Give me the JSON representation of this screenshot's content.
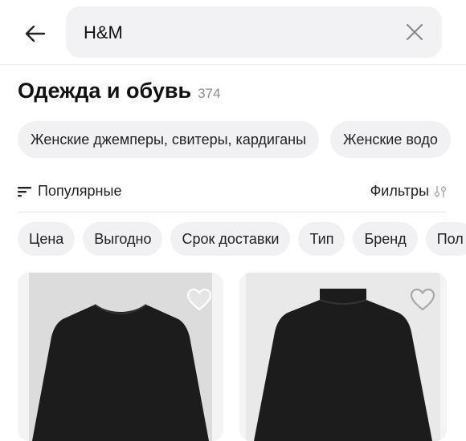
{
  "search": {
    "query": "H&M"
  },
  "category": {
    "title": "Одежда и обувь",
    "count": "374"
  },
  "category_chips": [
    "Женские джемперы, свитеры, кардиганы",
    "Женские водо"
  ],
  "sort": {
    "label": "Популярные"
  },
  "filters": {
    "label": "Фильтры"
  },
  "filter_chips": [
    "Цена",
    "Выгодно",
    "Срок доставки",
    "Тип",
    "Бренд",
    "Пол"
  ],
  "products": [
    {
      "image": "black-longsleeve-top-icon",
      "favorite_icon": "heart-outline-icon"
    },
    {
      "image": "black-turtleneck-top-icon",
      "favorite_icon": "heart-outline-icon"
    }
  ],
  "colors": {
    "background": "#ffffff",
    "chip": "#f1f1f3",
    "search_bg": "#f2f2f4",
    "garment": "#1c1c1c",
    "muted_text": "#8d8d8d"
  }
}
